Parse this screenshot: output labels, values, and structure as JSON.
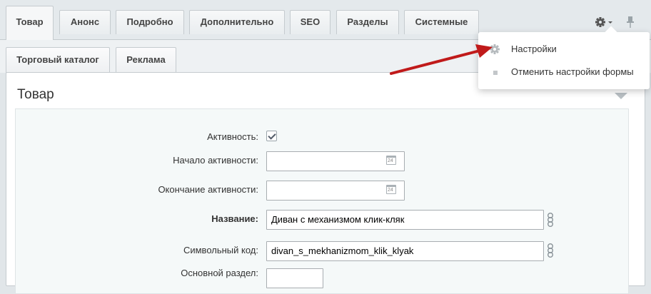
{
  "tabs": [
    {
      "label": "Товар",
      "active": true
    },
    {
      "label": "Анонс"
    },
    {
      "label": "Подробно"
    },
    {
      "label": "Дополнительно"
    },
    {
      "label": "SEO"
    },
    {
      "label": "Разделы"
    },
    {
      "label": "Системные"
    }
  ],
  "subtabs": [
    {
      "label": "Торговый каталог"
    },
    {
      "label": "Реклама"
    }
  ],
  "panel": {
    "title": "Товар"
  },
  "fields": {
    "active": {
      "label": "Активность:",
      "checked": true
    },
    "active_from": {
      "label": "Начало активности:",
      "value": ""
    },
    "active_to": {
      "label": "Окончание активности:",
      "value": ""
    },
    "name": {
      "label": "Название:",
      "value": "Диван с механизмом клик-кляк"
    },
    "code": {
      "label": "Символьный код:",
      "value": "divan_s_mekhanizmom_klik_klyak"
    },
    "section": {
      "label": "Основной раздел:"
    }
  },
  "calendar_icon_text": "24",
  "menu": {
    "items": [
      {
        "label": "Настройки",
        "icon": "gear-icon"
      },
      {
        "label": "Отменить настройки формы",
        "icon": "square-bullet-icon"
      }
    ]
  },
  "colors": {
    "annotation_arrow": "#c01a1a",
    "tab_bar": "#e4e9ec",
    "panel_bg": "#ffffff",
    "inner_bg": "#f5f9f9"
  }
}
